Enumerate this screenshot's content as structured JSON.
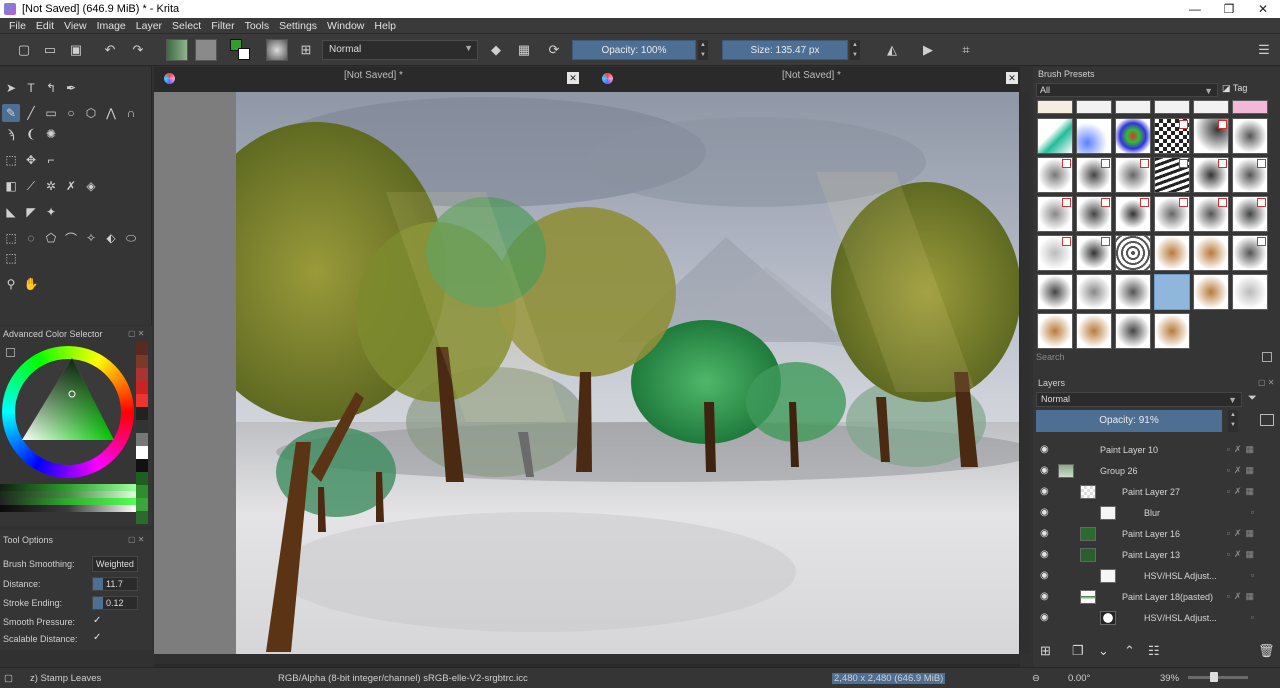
{
  "window": {
    "title": "[Not Saved]  (646.9 MiB)  * - Krita",
    "minimize": "—",
    "maximize": "❐",
    "close": "✕"
  },
  "menu": [
    "File",
    "Edit",
    "View",
    "Image",
    "Layer",
    "Select",
    "Filter",
    "Tools",
    "Settings",
    "Window",
    "Help"
  ],
  "toolbar": {
    "blend_mode": "Normal",
    "opacity": "Opacity: 100%",
    "size": "Size: 135.47 px",
    "colors": {
      "accent": "#4d6f94",
      "foreground": "#1a1a1a",
      "background": "#ffffff",
      "brush_color": "#2e9e2e"
    }
  },
  "tabs": [
    {
      "label": "[Not Saved]  *"
    },
    {
      "label": "[Not Saved]  *"
    }
  ],
  "dockers": {
    "advanced_color_selector": "Advanced Color Selector",
    "tool_options": "Tool Options",
    "brush_presets": "Brush Presets",
    "layers": "Layers"
  },
  "tool_options": {
    "brush_smoothing_label": "Brush Smoothing:",
    "brush_smoothing_value": "Weighted",
    "distance_label": "Distance:",
    "distance_value": "11.7",
    "stroke_ending_label": "Stroke Ending:",
    "stroke_ending_value": "0.12",
    "smooth_pressure_label": "Smooth Pressure:",
    "scalable_distance_label": "Scalable Distance:",
    "checked": "✓"
  },
  "brush_presets": {
    "filter": "All",
    "tag": "Tag",
    "search_placeholder": "Search"
  },
  "layers": {
    "blend_mode": "Normal",
    "opacity": "Opacity:  91%",
    "items": [
      {
        "name": "Paint Layer 10",
        "indent": 0
      },
      {
        "name": "Group 26",
        "indent": 0
      },
      {
        "name": "Paint Layer 27",
        "indent": 1
      },
      {
        "name": "Blur",
        "indent": 2
      },
      {
        "name": "Paint Layer 16",
        "indent": 1
      },
      {
        "name": "Paint Layer 13",
        "indent": 1
      },
      {
        "name": "HSV/HSL Adjust...",
        "indent": 2
      },
      {
        "name": "Paint Layer 18(pasted)",
        "indent": 1
      },
      {
        "name": "HSV/HSL Adjust...",
        "indent": 2
      }
    ]
  },
  "status": {
    "brush": "z) Stamp Leaves",
    "color_space": "RGB/Alpha (8-bit integer/channel)  sRGB-elle-V2-srgbtrc.icc",
    "dimensions": "2,480 x 2,480 (646.9 MiB)",
    "rotation": "0.00°",
    "zoom": "39%"
  }
}
